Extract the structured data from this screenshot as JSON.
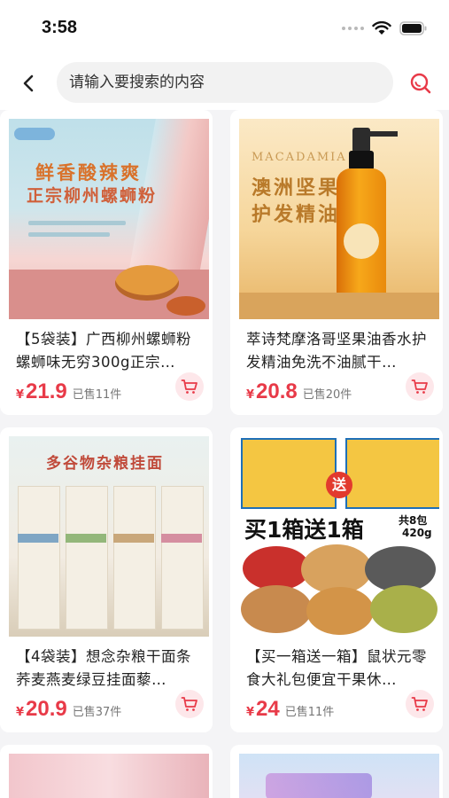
{
  "status_bar": {
    "time": "3:58"
  },
  "search": {
    "placeholder": "请输入要搜索的内容",
    "value": ""
  },
  "products": [
    {
      "title": "【5袋装】广西柳州螺蛳粉螺蛳味无穷300g正宗…",
      "currency": "¥",
      "price": "21.9",
      "sold": "已售11件",
      "image_text": [
        "鲜香酸辣爽",
        "正宗柳州螺蛳粉"
      ]
    },
    {
      "title": "萃诗梵摩洛哥坚果油香水护发精油免洗不油腻干…",
      "currency": "¥",
      "price": "20.8",
      "sold": "已售20件",
      "image_text": [
        "MACADAMIA",
        "澳洲坚果",
        "护发精油"
      ]
    },
    {
      "title": "【4袋装】想念杂粮干面条荞麦燕麦绿豆挂面藜…",
      "currency": "¥",
      "price": "20.9",
      "sold": "已售37件",
      "image_text": [
        "多谷物杂粮挂面"
      ]
    },
    {
      "title": "【买一箱送一箱】鼠状元零食大礼包便宜干果休…",
      "currency": "¥",
      "price": "24",
      "sold": "已售11件",
      "image_text": [
        "买1箱送1箱",
        "共8包",
        "420g",
        "送"
      ]
    }
  ],
  "colors": {
    "accent": "#e83a48",
    "cart_bg": "#fde7ea",
    "page_bg": "#f4f4f6"
  }
}
